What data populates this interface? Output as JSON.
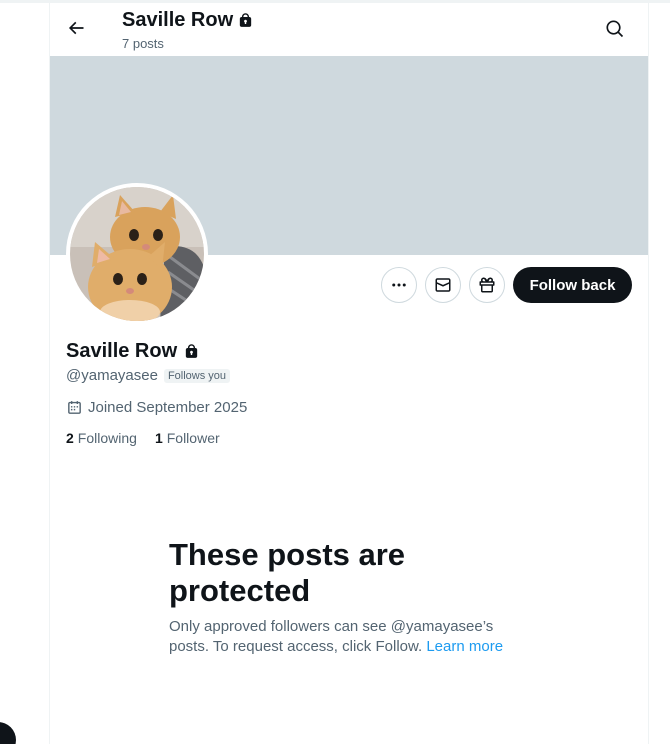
{
  "header": {
    "title": "Saville Row",
    "posts_count": "7 posts"
  },
  "profile": {
    "display_name": "Saville Row",
    "handle": "@yamayasee",
    "follows_badge": "Follows you",
    "joined": "Joined September 2025",
    "following_count": "2",
    "following_label": "Following",
    "followers_count": "1",
    "followers_label": "Follower"
  },
  "actions": {
    "follow_label": "Follow back"
  },
  "protected": {
    "title": "These posts are protected",
    "description": "Only approved followers can see @yamayasee’s posts. To request access, click Follow. ",
    "learn_more": "Learn more"
  },
  "colors": {
    "banner": "#cfd9de",
    "accent": "#1d9bf0",
    "follow_button": "#0f1419"
  },
  "icons": {
    "back": "arrow-left-icon",
    "search": "search-icon",
    "lock": "lock-icon",
    "more": "more-horizontal-icon",
    "message": "envelope-icon",
    "gift": "gift-icon",
    "calendar": "calendar-icon"
  }
}
